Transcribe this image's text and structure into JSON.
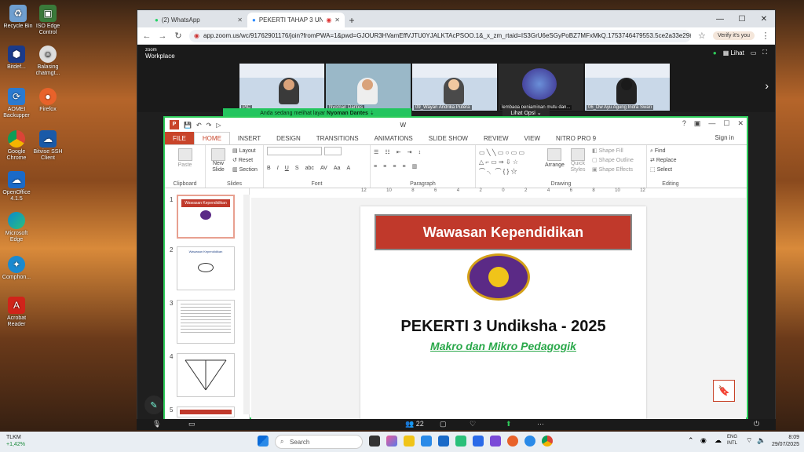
{
  "desktop": {
    "icons": [
      {
        "label": "Recycle Bin"
      },
      {
        "label": "ISO Edge Control"
      },
      {
        "label": "Bitdef..."
      },
      {
        "label": "Balasing chatmgt..."
      },
      {
        "label": "AOMEI Backupper"
      },
      {
        "label": "Firefox"
      },
      {
        "label": "Google Chrome"
      },
      {
        "label": "Bitvise SSH Client"
      },
      {
        "label": "OpenOffice 4.1.5"
      },
      {
        "label": "Microsoft Edge"
      },
      {
        "label": "Comphon..."
      },
      {
        "label": "Acrobat Reader"
      }
    ]
  },
  "browser": {
    "tabs": [
      {
        "label": "(2) WhatsApp",
        "active": false
      },
      {
        "label": "PEKERTI TAHAP 3 UNDIKSHA",
        "active": true
      }
    ],
    "url": "app.zoom.us/wc/91762901176/join?fromPWA=1&pwd=GJOUR3HVamEffVJTU0YJALKTAcPSOO.1&_x_zm_rtaid=IS3GrU6eSGyPoBZ7MFxMkQ.1753746479553.5ce2a33e298dd516cb0e23b...",
    "verify_label": "Verify it's you"
  },
  "zoom": {
    "brand_top": "zoom",
    "brand_bottom": "Workplace",
    "view_label": "Lihat",
    "participants": [
      {
        "name": "PIC"
      },
      {
        "name": "Nyoman Dantes"
      },
      {
        "name": "09_Wayan Andrika Putera"
      },
      {
        "name": "lembaga penjaminan mutu dan..."
      },
      {
        "name": "06_Dw Ayu Agung Indra Swari"
      }
    ],
    "sharing_notice_prefix": "Anda sedang melihat layar",
    "sharing_name": "Nyoman Dantes",
    "view_options": "Lihat Opsi",
    "participant_count": "22"
  },
  "ppt": {
    "title_fragment": "W",
    "ribbon_tabs": [
      "FILE",
      "HOME",
      "INSERT",
      "DESIGN",
      "TRANSITIONS",
      "ANIMATIONS",
      "SLIDE SHOW",
      "REVIEW",
      "VIEW",
      "NITRO PRO 9"
    ],
    "sign_in": "Sign in",
    "groups": {
      "clipboard": "Clipboard",
      "slides": "Slides",
      "font": "Font",
      "paragraph": "Paragraph",
      "drawing": "Drawing",
      "editing": "Editing"
    },
    "buttons": {
      "paste": "Paste",
      "new_slide": "New Slide",
      "layout": "Layout",
      "reset": "Reset",
      "section": "Section",
      "arrange": "Arrange",
      "quick_styles": "Quick Styles",
      "shape_fill": "Shape Fill",
      "shape_outline": "Shape Outline",
      "shape_effects": "Shape Effects",
      "find": "Find",
      "replace": "Replace",
      "select": "Select"
    },
    "ruler_labels": [
      "12",
      "10",
      "8",
      "6",
      "4",
      "2",
      "0",
      "2",
      "4",
      "6",
      "8",
      "10",
      "12"
    ],
    "slide_numbers": [
      "1",
      "2",
      "3",
      "4",
      "5"
    ],
    "thumb_titles": [
      "Wawasan Kependidikan",
      "Wawasan Kependidikan"
    ],
    "slide": {
      "banner": "Wawasan Kependidikan",
      "title": "PEKERTI 3 Undiksha - 2025",
      "subtitle": "Makro dan Mikro Pedagogik"
    }
  },
  "taskbar": {
    "ticker": "TLKM",
    "change": "+1,42%",
    "search_placeholder": "Search",
    "lang_top": "ENG",
    "lang_bottom": "INTL",
    "time": "8:09",
    "date": "29/07/2025"
  }
}
